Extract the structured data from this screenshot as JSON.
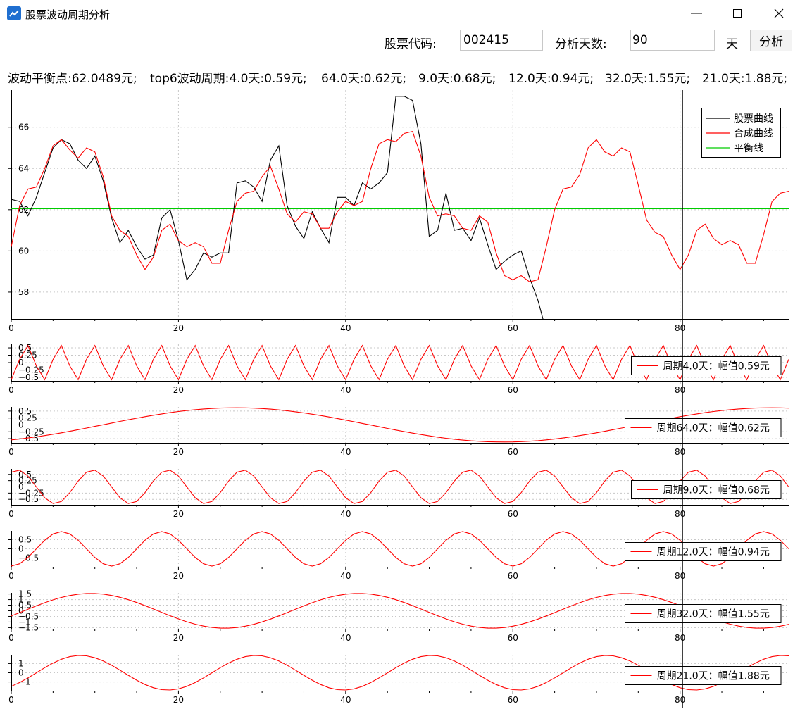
{
  "window": {
    "title": "股票波动周期分析",
    "minimize_glyph": "minimize-icon",
    "maximize_glyph": "maximize-icon",
    "close_glyph": "close-icon"
  },
  "toolbar": {
    "code_label": "股票代码:",
    "code_value": "002415",
    "days_label": "分析天数:",
    "days_value": "90",
    "days_unit": "天",
    "analyze_label": "分析"
  },
  "summary": {
    "balance": "波动平衡点:62.0489元;",
    "top": "top6波动周期:4.0天:0.59元;",
    "p2": "64.0天:0.62元;",
    "p3": "9.0天:0.68元;",
    "p4": "12.0天:0.94元;",
    "p5": "32.0天:1.55元;",
    "p6": "21.0天:1.88元;"
  },
  "colors": {
    "stock": "#000000",
    "synth": "#ff0000",
    "balance": "#00cc00",
    "grid": "#c8c8c8",
    "cursor": "#000000"
  },
  "cursor_x_value": 80.3,
  "chart_data": [
    {
      "type": "line",
      "xlim": [
        0,
        93
      ],
      "ylim": [
        56.7,
        67.8
      ],
      "x_ticks": [
        0,
        20,
        40,
        60,
        80
      ],
      "y_ticks": [
        58,
        60,
        62,
        64,
        66
      ],
      "legend_position": "top-right",
      "legend": [
        "股票曲线",
        "合成曲线",
        "平衡线"
      ],
      "balance": 62.05,
      "series": [
        {
          "name": "股票曲线",
          "values": [
            62.5,
            62.4,
            61.7,
            62.6,
            63.8,
            65.0,
            65.4,
            65.2,
            64.4,
            64.0,
            64.6,
            63.4,
            61.6,
            60.4,
            61.0,
            60.2,
            59.6,
            59.8,
            61.6,
            62.0,
            60.5,
            58.6,
            59.1,
            59.9,
            59.7,
            59.9,
            59.9,
            63.3,
            63.4,
            63.1,
            62.4,
            64.4,
            65.1,
            62.2,
            61.2,
            60.6,
            61.9,
            61.1,
            60.4,
            62.6,
            62.6,
            62.2,
            63.3,
            63.0,
            63.3,
            63.8,
            67.5,
            67.5,
            67.3,
            65.2,
            60.7,
            61.0,
            62.8,
            61.0,
            61.1,
            60.5,
            61.6,
            60.3,
            59.1,
            59.5,
            59.8,
            60.0,
            58.7,
            57.6,
            56.1
          ]
        },
        {
          "name": "合成曲线",
          "values": [
            60.2,
            62.2,
            63.0,
            63.1,
            64.0,
            65.1,
            65.4,
            64.9,
            64.5,
            65.0,
            64.8,
            63.6,
            61.7,
            61.0,
            60.7,
            59.8,
            59.1,
            59.7,
            61.0,
            61.3,
            60.5,
            60.2,
            60.4,
            60.2,
            59.4,
            59.4,
            61.0,
            62.4,
            62.8,
            62.9,
            63.6,
            64.1,
            63.0,
            61.8,
            61.4,
            61.9,
            61.8,
            61.1,
            61.1,
            61.9,
            62.4,
            62.2,
            62.4,
            64.0,
            65.2,
            65.4,
            65.3,
            65.7,
            65.8,
            64.6,
            62.6,
            61.7,
            61.8,
            61.7,
            61.1,
            61.0,
            61.7,
            61.4,
            59.9,
            58.8,
            58.6,
            58.8,
            58.5,
            58.6,
            60.2,
            62.0,
            63.0,
            63.1,
            63.7,
            65.0,
            65.4,
            64.8,
            64.6,
            65.0,
            64.8,
            63.2,
            61.5,
            60.9,
            60.7,
            59.8,
            59.1,
            59.8,
            61.0,
            61.3,
            60.6,
            60.3,
            60.5,
            60.3,
            59.4,
            59.4,
            60.8,
            62.4,
            62.8,
            62.9
          ]
        }
      ]
    },
    {
      "type": "line",
      "xlim": [
        0,
        93
      ],
      "ylim": [
        -0.62,
        0.62
      ],
      "x_ticks": [
        0,
        20,
        40,
        60,
        80
      ],
      "y_ticks": [
        -0.5,
        -0.25,
        0,
        0.25,
        0.5
      ],
      "legend_position": "bottom-right",
      "legend": [
        "周期4.0天：幅值0.59元"
      ],
      "period": 4.0,
      "amplitude": 0.59,
      "phase": 4.9
    },
    {
      "type": "line",
      "xlim": [
        0,
        93
      ],
      "ylim": [
        -0.65,
        0.65
      ],
      "x_ticks": [
        0,
        20,
        40,
        60,
        80
      ],
      "y_ticks": [
        -0.5,
        -0.25,
        0,
        0.25,
        0.5
      ],
      "legend_position": "bottom-right",
      "legend": [
        "周期64.0天：幅值0.62元"
      ],
      "period": 64.0,
      "amplitude": 0.62,
      "phase": -1.07
    },
    {
      "type": "line",
      "xlim": [
        0,
        93
      ],
      "ylim": [
        -0.72,
        0.72
      ],
      "x_ticks": [
        0,
        20,
        40,
        60,
        80
      ],
      "y_ticks": [
        -0.5,
        -0.25,
        0,
        0.25,
        0.5
      ],
      "legend_position": "bottom-right",
      "legend": [
        "周期9.0天：幅值0.68元"
      ],
      "period": 9.0,
      "amplitude": 0.68,
      "phase": 1.05
    },
    {
      "type": "line",
      "xlim": [
        0,
        93
      ],
      "ylim": [
        -0.98,
        0.98
      ],
      "x_ticks": [
        0,
        20,
        40,
        60,
        80
      ],
      "y_ticks": [
        -0.5,
        0,
        0.5
      ],
      "legend_position": "bottom-right",
      "legend": [
        "周期12.0天：幅值0.94元"
      ],
      "period": 12.0,
      "amplitude": 0.94,
      "phase": -1.57
    },
    {
      "type": "line",
      "xlim": [
        0,
        93
      ],
      "ylim": [
        -1.6,
        1.6
      ],
      "x_ticks": [
        0,
        20,
        40,
        60,
        80
      ],
      "y_ticks": [
        -1.5,
        -1,
        -0.5,
        0,
        0.5,
        1,
        1.5
      ],
      "legend_position": "bottom-right",
      "legend": [
        "周期32.0天：幅值1.55元"
      ],
      "period": 32.0,
      "amplitude": 1.55,
      "phase": -0.3
    },
    {
      "type": "line",
      "xlim": [
        0,
        93
      ],
      "ylim": [
        -1.95,
        1.95
      ],
      "x_ticks": [
        0,
        20,
        40,
        60,
        80
      ],
      "y_ticks": [
        -1,
        0,
        1
      ],
      "legend_position": "bottom-right",
      "legend": [
        "周期21.0天：幅值1.88元"
      ],
      "period": 21.0,
      "amplitude": 1.88,
      "phase": -0.9
    }
  ]
}
